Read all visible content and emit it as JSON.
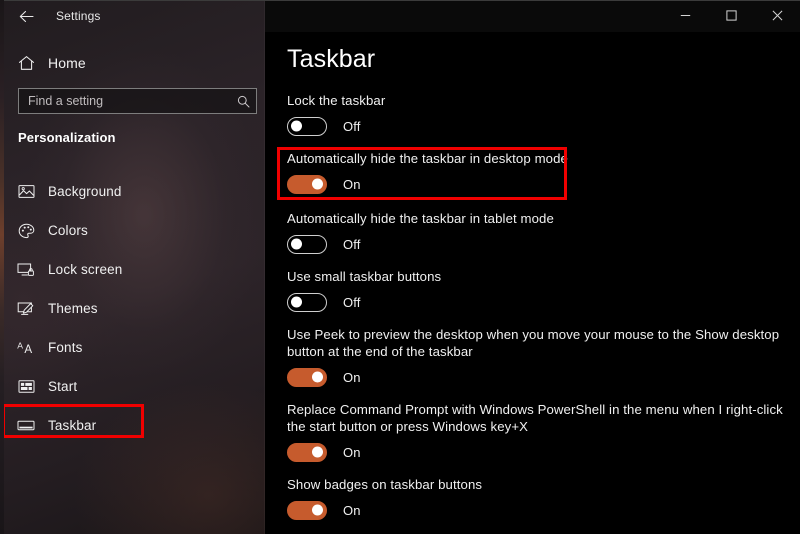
{
  "window": {
    "app_title": "Settings",
    "back_icon": "back-arrow-icon",
    "controls": {
      "minimize": "minimize-icon",
      "maximize": "maximize-icon",
      "close": "close-icon"
    }
  },
  "sidebar": {
    "home_label": "Home",
    "home_icon": "home-icon",
    "search": {
      "placeholder": "Find a setting",
      "value": "",
      "icon": "search-icon"
    },
    "section_header": "Personalization",
    "items": [
      {
        "label": "Background",
        "icon": "image-icon",
        "selected": false
      },
      {
        "label": "Colors",
        "icon": "palette-icon",
        "selected": false
      },
      {
        "label": "Lock screen",
        "icon": "lock-screen-icon",
        "selected": false
      },
      {
        "label": "Themes",
        "icon": "brush-icon",
        "selected": false
      },
      {
        "label": "Fonts",
        "icon": "font-icon",
        "selected": false
      },
      {
        "label": "Start",
        "icon": "start-tiles-icon",
        "selected": false
      },
      {
        "label": "Taskbar",
        "icon": "taskbar-icon",
        "selected": true
      }
    ]
  },
  "main": {
    "page_title": "Taskbar",
    "settings": [
      {
        "label": "Lock the taskbar",
        "state": "Off",
        "on": false
      },
      {
        "label": "Automatically hide the taskbar in desktop mode",
        "state": "On",
        "on": true
      },
      {
        "label": "Automatically hide the taskbar in tablet mode",
        "state": "Off",
        "on": false
      },
      {
        "label": "Use small taskbar buttons",
        "state": "Off",
        "on": false
      },
      {
        "label": "Use Peek to preview the desktop when you move your mouse to the Show desktop button at the end of the taskbar",
        "state": "On",
        "on": true
      },
      {
        "label": "Replace Command Prompt with Windows PowerShell in the menu when I right-click the start button or press Windows key+X",
        "state": "On",
        "on": true
      },
      {
        "label": "Show badges on taskbar buttons",
        "state": "On",
        "on": true
      }
    ]
  },
  "annotations": {
    "highlight_color": "#f00000",
    "highlighted_nav_item": "Taskbar",
    "highlighted_setting": "Automatically hide the taskbar in desktop mode"
  },
  "colors": {
    "accent_toggle_on": "#c65b2d",
    "content_background": "#000000",
    "sidebar_background": "#2b2328",
    "text_primary": "#f0f0f0"
  }
}
